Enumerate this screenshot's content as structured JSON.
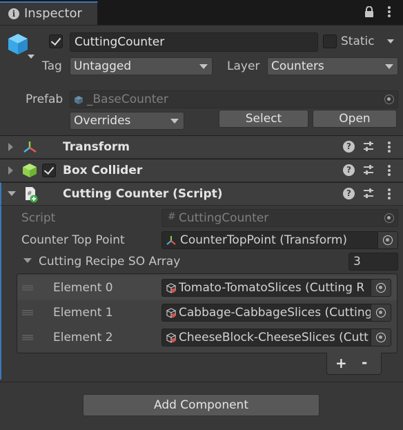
{
  "tab": {
    "title": "Inspector"
  },
  "object": {
    "name": "CuttingCounter",
    "static_label": "Static",
    "tag_label": "Tag",
    "tag_value": "Untagged",
    "layer_label": "Layer",
    "layer_value": "Counters"
  },
  "prefab": {
    "label": "Prefab",
    "value": "_BaseCounter",
    "overrides_label": "Overrides",
    "select_label": "Select",
    "open_label": "Open"
  },
  "components": {
    "transform": "Transform",
    "box_collider": "Box Collider",
    "script": "Cutting Counter (Script)"
  },
  "script_fields": {
    "script_label": "Script",
    "script_value": "CuttingCounter",
    "counter_top_label": "Counter Top Point",
    "counter_top_value": "CounterTopPoint (Transform)",
    "array_label": "Cutting Recipe SO Array",
    "array_size": "3",
    "elements": [
      {
        "label": "Element 0",
        "value": "Tomato-TomatoSlices (Cutting R"
      },
      {
        "label": "Element 1",
        "value": "Cabbage-CabbageSlices (Cutting"
      },
      {
        "label": "Element 2",
        "value": "CheeseBlock-CheeseSlices (Cutt"
      }
    ],
    "add_symbol": "+",
    "remove_symbol": "-"
  },
  "footer": {
    "add_component_label": "Add Component"
  },
  "colors": {
    "accent": "#3a79bb",
    "cube": "#4cb4ef",
    "collider": "#8fd14f"
  }
}
